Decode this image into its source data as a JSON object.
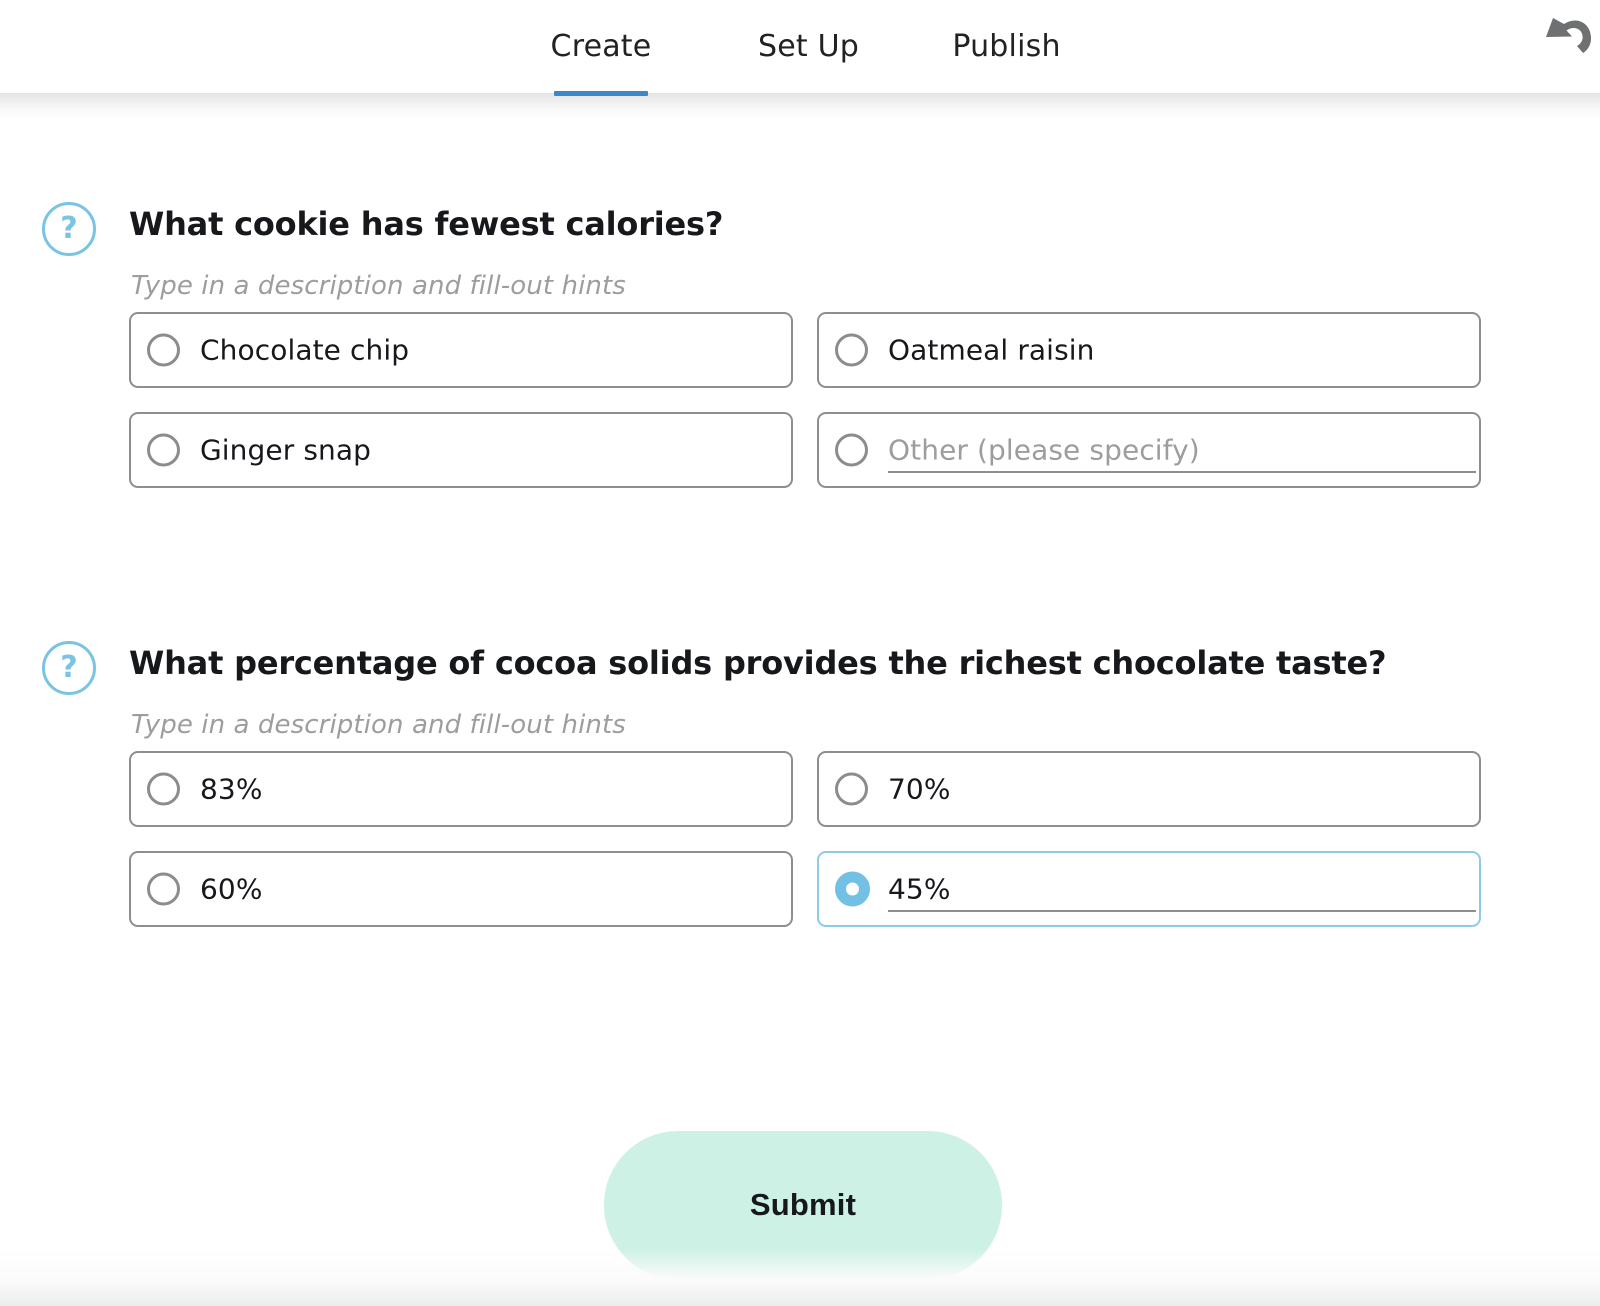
{
  "header": {
    "tabs": [
      {
        "label": "Create",
        "active": true
      },
      {
        "label": "Set Up",
        "active": false
      },
      {
        "label": "Publish",
        "active": false
      }
    ],
    "undo_icon": "undo-arrow-icon",
    "active_tab_color": "#3b87c8"
  },
  "colors": {
    "accent_blue": "#79c3e3",
    "tab_underline": "#3b87c8",
    "submit_background": "#cdf1e4",
    "option_border": "#8e8e8e",
    "selected_border": "#8dcbe6",
    "hint_text": "#9d9d9d"
  },
  "questions": [
    {
      "icon": "question-mark-icon",
      "title": "What cookie has fewest calories?",
      "hint": "Type in a description and fill-out hints",
      "options": [
        {
          "label": "Chocolate chip",
          "selected": false,
          "is_placeholder": false,
          "has_underline": false
        },
        {
          "label": "Oatmeal raisin",
          "selected": false,
          "is_placeholder": false,
          "has_underline": false
        },
        {
          "label": "Ginger snap",
          "selected": false,
          "is_placeholder": false,
          "has_underline": false
        },
        {
          "label": "Other (please specify)",
          "selected": false,
          "is_placeholder": true,
          "has_underline": true
        }
      ]
    },
    {
      "icon": "question-mark-icon",
      "title": "What percentage of cocoa solids provides the richest chocolate taste?",
      "hint": "Type in a description and fill-out hints",
      "options": [
        {
          "label": "83%",
          "selected": false,
          "is_placeholder": false,
          "has_underline": false
        },
        {
          "label": "70%",
          "selected": false,
          "is_placeholder": false,
          "has_underline": false
        },
        {
          "label": "60%",
          "selected": false,
          "is_placeholder": false,
          "has_underline": false
        },
        {
          "label": "45%",
          "selected": true,
          "is_placeholder": false,
          "has_underline": true
        }
      ]
    }
  ],
  "submit": {
    "label": "Submit"
  }
}
